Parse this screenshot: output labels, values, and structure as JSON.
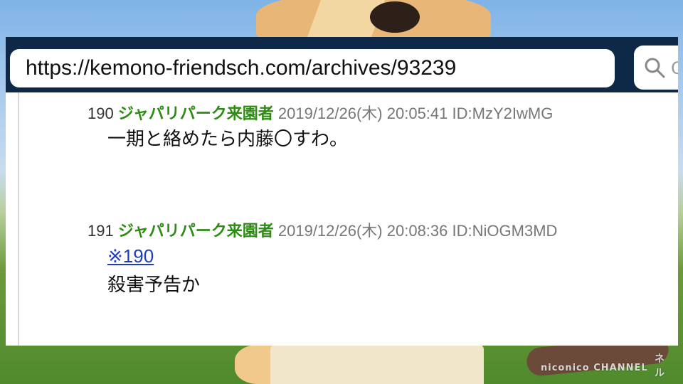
{
  "browser": {
    "url": "https://kemono-friendsch.com/archives/93239",
    "search_placeholder": "Q"
  },
  "posts": [
    {
      "number": "190",
      "name": "ジャパリパーク来園者",
      "datetime": "2019/12/26(木) 20:05:41",
      "id": "ID:MzY2IwMG",
      "lines": [
        "一期と絡めたら内藤〇すわ。"
      ]
    },
    {
      "number": "191",
      "name": "ジャパリパーク来園者",
      "datetime": "2019/12/26(木) 20:08:36",
      "id": "ID:NiOGM3MD",
      "anchor": "※190",
      "lines": [
        "殺害予告か"
      ]
    }
  ],
  "background": {
    "watermark_top": "ネル",
    "watermark_bottom": "niconico CHANNEL"
  },
  "colors": {
    "topbar": "#0e2848",
    "name": "#2e8b14",
    "anchor": "#1f3bbf"
  }
}
